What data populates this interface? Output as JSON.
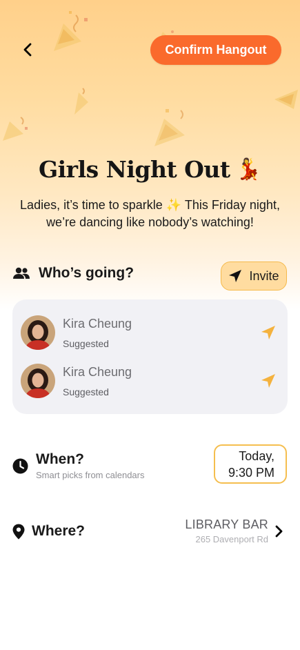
{
  "header": {
    "confirm_label": "Confirm Hangout"
  },
  "event": {
    "title": "Girls Night Out",
    "title_emoji": "💃",
    "description": "Ladies, it’s time to sparkle ✨ This Friday night, we’re dancing like nobody’s watching!"
  },
  "guests": {
    "section_title": "Who’s going?",
    "invite_label": "Invite",
    "people": [
      {
        "name": "Kira Cheung",
        "status": "Suggested"
      },
      {
        "name": "Kira Cheung",
        "status": "Suggested"
      }
    ]
  },
  "when": {
    "title": "When?",
    "subtitle": "Smart picks from calendars",
    "day": "Today,",
    "time": "9:30 PM"
  },
  "where": {
    "title": "Where?",
    "venue_name": "LIBRARY BAR",
    "venue_address": "265 Davenport Rd"
  },
  "colors": {
    "accent_orange": "#fa6a2c",
    "accent_yellow": "#f5b94a",
    "card_bg": "#f1f1f5"
  }
}
